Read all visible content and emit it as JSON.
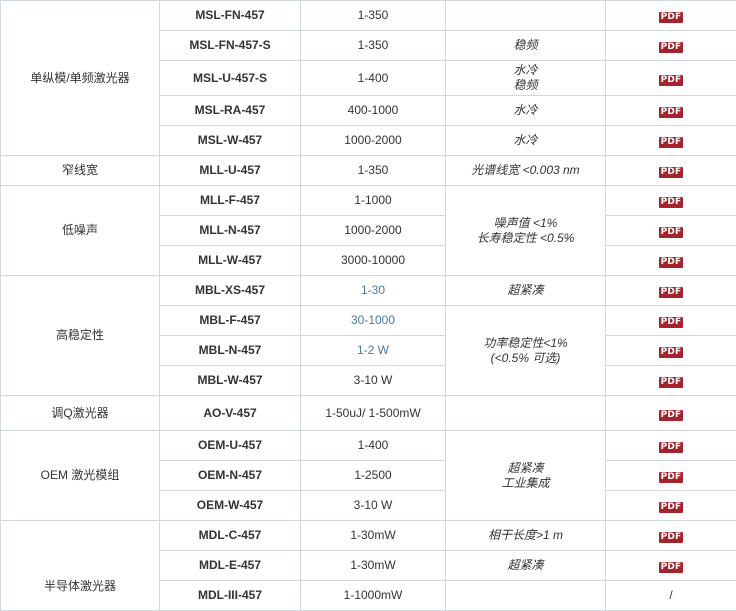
{
  "rows": [
    {
      "model": "MSL-FN-457",
      "power": "1-350",
      "notes": []
    },
    {
      "model": "MSL-FN-457-S",
      "power": "1-350",
      "notes": [
        "稳频"
      ]
    },
    {
      "model": "MSL-U-457-S",
      "power": "1-400",
      "notes": [
        "水冷",
        "稳频"
      ]
    },
    {
      "model": "MSL-RA-457",
      "power": "400-1000",
      "notes": [
        "水冷"
      ]
    },
    {
      "model": "MSL-W-457",
      "power": "1000-2000",
      "notes": [
        "水冷"
      ]
    },
    {
      "model": "MLL-U-457",
      "power": "1-350",
      "notes": [
        "光谱线宽 <0.003 nm"
      ]
    },
    {
      "model": "MLL-F-457",
      "power": "1-1000"
    },
    {
      "model": "MLL-N-457",
      "power": "1000-2000"
    },
    {
      "model": "MLL-W-457",
      "power": "3000-10000"
    },
    {
      "model": "MBL-XS-457",
      "power": "1-30",
      "notes": [
        "超紧凑"
      ]
    },
    {
      "model": "MBL-F-457",
      "power": "30-1000"
    },
    {
      "model": "MBL-N-457",
      "power": "1-2 W"
    },
    {
      "model": "MBL-W-457",
      "power": "3-10 W"
    },
    {
      "model": "AO-V-457",
      "power": "1-50uJ/ 1-500mW",
      "notes": []
    },
    {
      "model": "OEM-U-457",
      "power": "1-400"
    },
    {
      "model": "OEM-N-457",
      "power": "1-2500"
    },
    {
      "model": "OEM-W-457",
      "power": "3-10 W"
    },
    {
      "model": "MDL-C-457",
      "power": "1-30mW",
      "notes": [
        "相干长度>1 m"
      ]
    },
    {
      "model": "MDL-E-457",
      "power": "1-30mW",
      "notes": [
        "超紧凑"
      ]
    },
    {
      "model": "MDL-III-457",
      "power": "1-1000mW",
      "notes": []
    }
  ],
  "categories": [
    "单纵模/单频激光器",
    "窄线宽",
    "低噪声",
    "高稳定性",
    "调Q激光器",
    "OEM 激光模组",
    "半导体激光器"
  ],
  "merged_notes": {
    "low_noise": [
      "噪声值 <1%",
      "长寿稳定性 <0.5%"
    ],
    "high_stability": [
      "功率稳定性<1%",
      "(<0.5% 可选)"
    ],
    "oem": [
      "超紧凑",
      "工业集成"
    ]
  },
  "pdf_label": "PDF",
  "no_pdf_label": "/",
  "colors": {
    "pdf_icon": "#a5232d",
    "note_text": "#cc1f1f",
    "category_text": "#1c2f6b",
    "blue_power": "#4a78a6",
    "border": "#d2d8e0"
  }
}
